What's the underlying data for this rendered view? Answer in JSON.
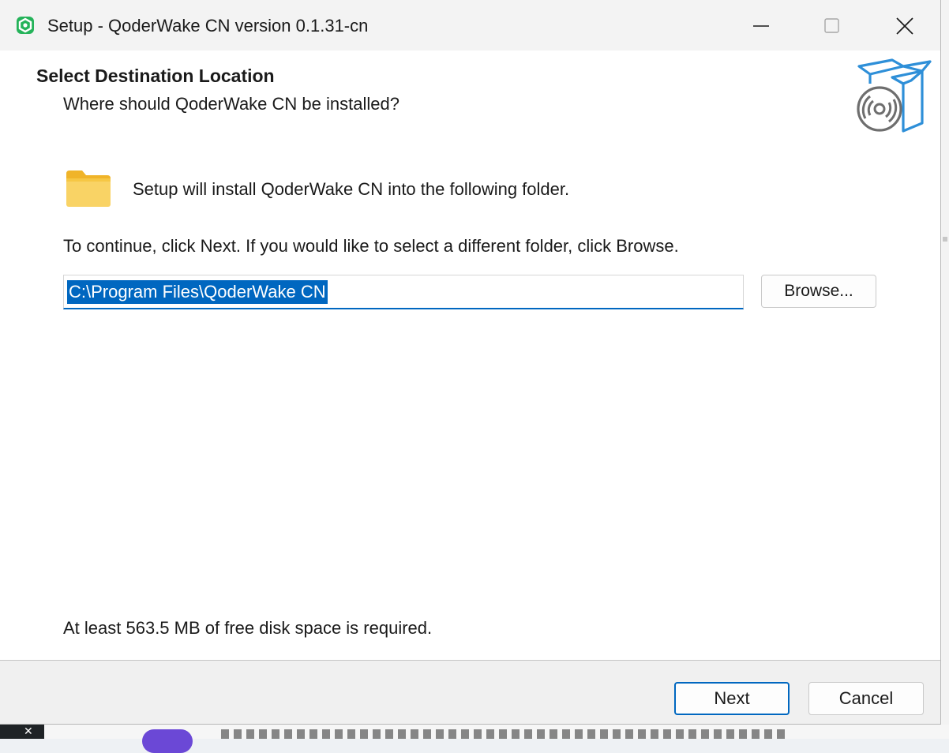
{
  "window": {
    "title": "Setup - QoderWake CN version 0.1.31-cn",
    "icon": "app-logo-icon",
    "controls": [
      "minimize-icon",
      "maximize-icon",
      "close-icon"
    ]
  },
  "header": {
    "heading": "Select Destination Location",
    "subheading": "Where should QoderWake CN be installed?",
    "icon": "install-box-icon"
  },
  "main": {
    "folder_icon": "folder-icon",
    "install_text": "Setup will install QoderWake CN into the following folder.",
    "continue_text": "To continue, click Next. If you would like to select a different folder, click Browse.",
    "path_value": "C:\\Program Files\\QoderWake CN",
    "browse_label": "Browse...",
    "disk_space_text": "At least 563.5 MB of free disk space is required."
  },
  "footer": {
    "next_label": "Next",
    "cancel_label": "Cancel"
  },
  "colors": {
    "accent": "#0067c0",
    "titlebar": "#f3f3f3",
    "footer": "#f0f0f0",
    "folder": "#f7c948",
    "app_icon": "#25b35a"
  }
}
